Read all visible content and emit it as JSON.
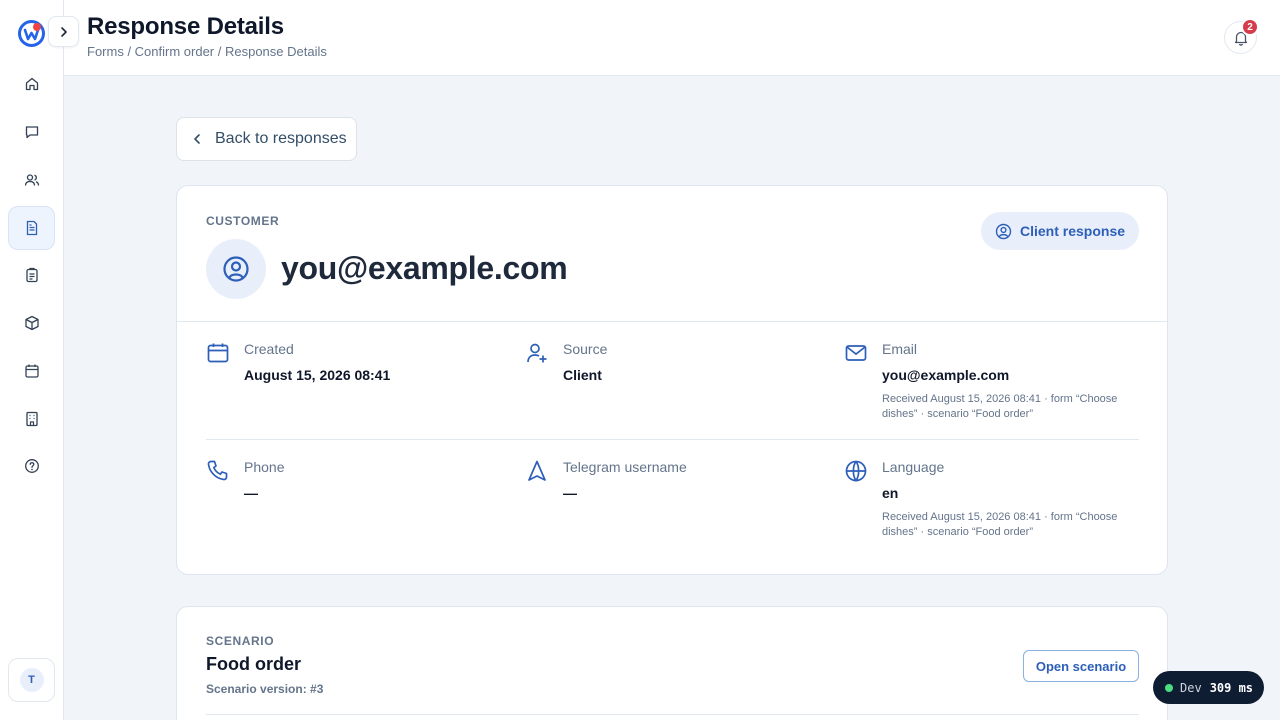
{
  "header": {
    "title": "Response Details",
    "breadcrumb": "Forms / Confirm order / Response Details",
    "notification_count": "2"
  },
  "sidebar": {
    "items": [
      {
        "icon": "home-icon"
      },
      {
        "icon": "chat-icon"
      },
      {
        "icon": "users-icon"
      },
      {
        "icon": "document-icon",
        "active": true
      },
      {
        "icon": "clipboard-icon"
      },
      {
        "icon": "box-icon"
      },
      {
        "icon": "calendar-icon"
      },
      {
        "icon": "building-icon"
      },
      {
        "icon": "help-icon"
      }
    ],
    "avatar_initial": "T"
  },
  "back_button": {
    "label": "Back to responses"
  },
  "customer": {
    "section_label": "CUSTOMER",
    "email": "you@example.com",
    "badge_label": "Client response",
    "fields": {
      "created": {
        "label": "Created",
        "value": "August 15, 2026 08:41"
      },
      "source": {
        "label": "Source",
        "value": "Client"
      },
      "email": {
        "label": "Email",
        "value": "you@example.com",
        "note": "Received August 15, 2026 08:41 · form “Choose dishes” · scenario “Food order”"
      },
      "phone": {
        "label": "Phone",
        "value": "—"
      },
      "telegram": {
        "label": "Telegram username",
        "value": "—"
      },
      "language": {
        "label": "Language",
        "value": "en",
        "note": "Received August 15, 2026 08:41 · form “Choose dishes” · scenario “Food order”"
      }
    }
  },
  "scenario": {
    "section_label": "SCENARIO",
    "title": "Food order",
    "version": "Scenario version: #3",
    "open_label": "Open scenario"
  },
  "dev": {
    "label": "Dev",
    "ms": "309 ms"
  },
  "colors": {
    "accent": "#2d5fb8",
    "accent_light": "#e8effb",
    "badge": "#d63d4b"
  }
}
